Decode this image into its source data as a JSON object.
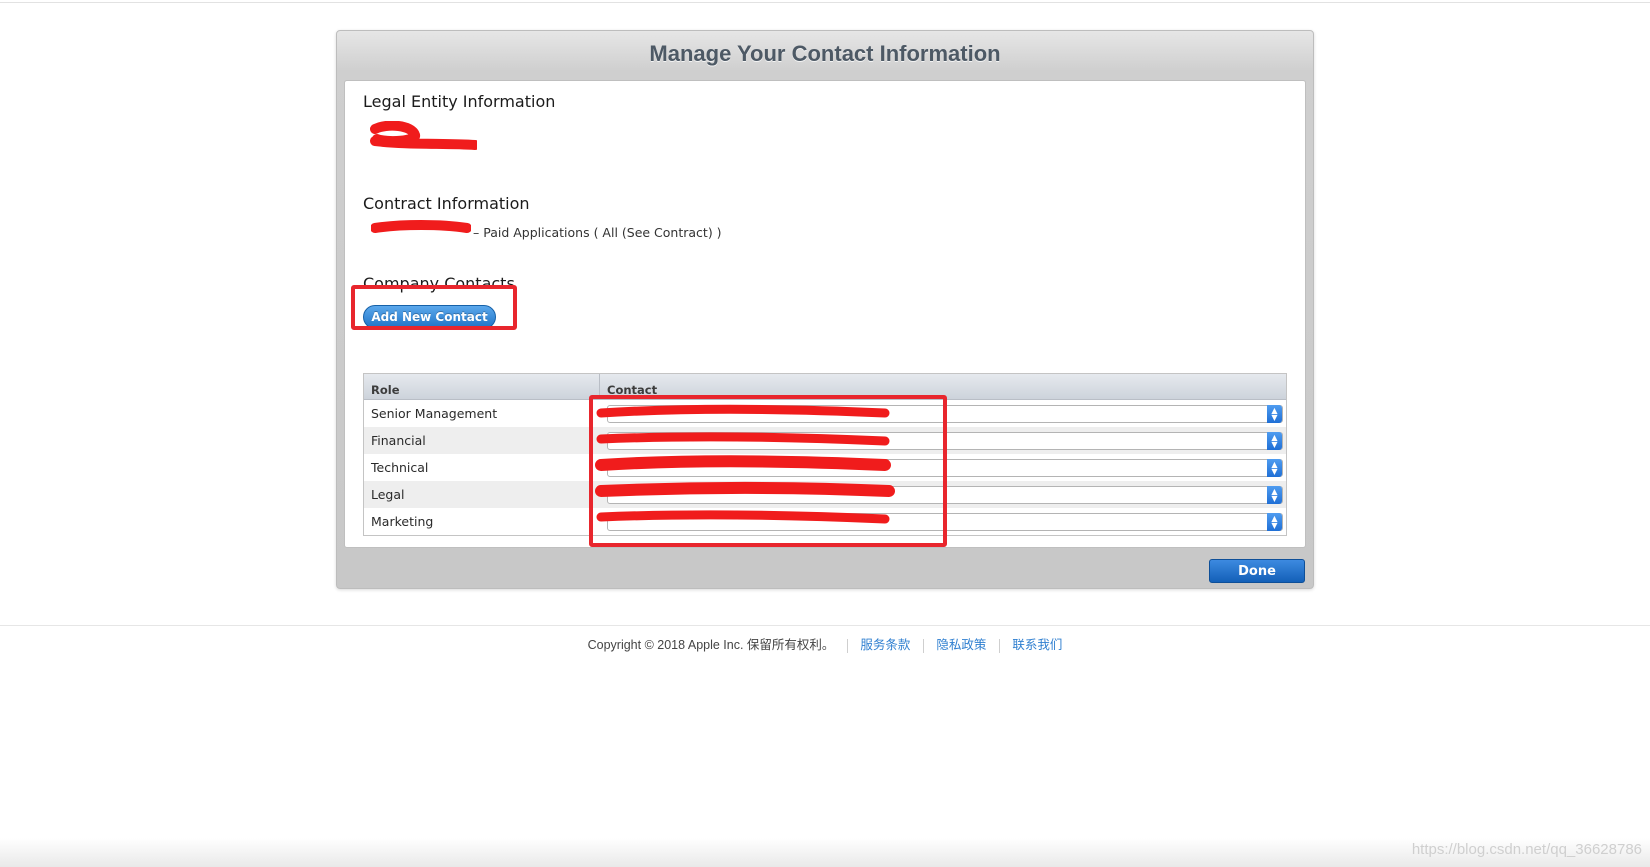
{
  "modal": {
    "title": "Manage Your Contact Information",
    "legal_heading": "Legal Entity Information",
    "contract_heading": "Contract Information",
    "contract_text": "– Paid Applications ( All (See Contract) )",
    "company_heading": "Company Contacts",
    "add_contact_label": "Add New Contact",
    "done_label": "Done"
  },
  "table": {
    "headers": {
      "role": "Role",
      "contact": "Contact"
    },
    "rows": [
      {
        "role": "Senior Management"
      },
      {
        "role": "Financial"
      },
      {
        "role": "Technical"
      },
      {
        "role": "Legal"
      },
      {
        "role": "Marketing"
      }
    ]
  },
  "footer": {
    "copyright": "Copyright © 2018 Apple Inc. 保留所有权利。",
    "links": [
      "服务条款",
      "隐私政策",
      "联系我们"
    ]
  },
  "watermark": "https://blog.csdn.net/qq_36628786",
  "colors": {
    "annotation": "#e8262d",
    "primary_button": "#1f73c6",
    "link": "#2f7fd0"
  }
}
